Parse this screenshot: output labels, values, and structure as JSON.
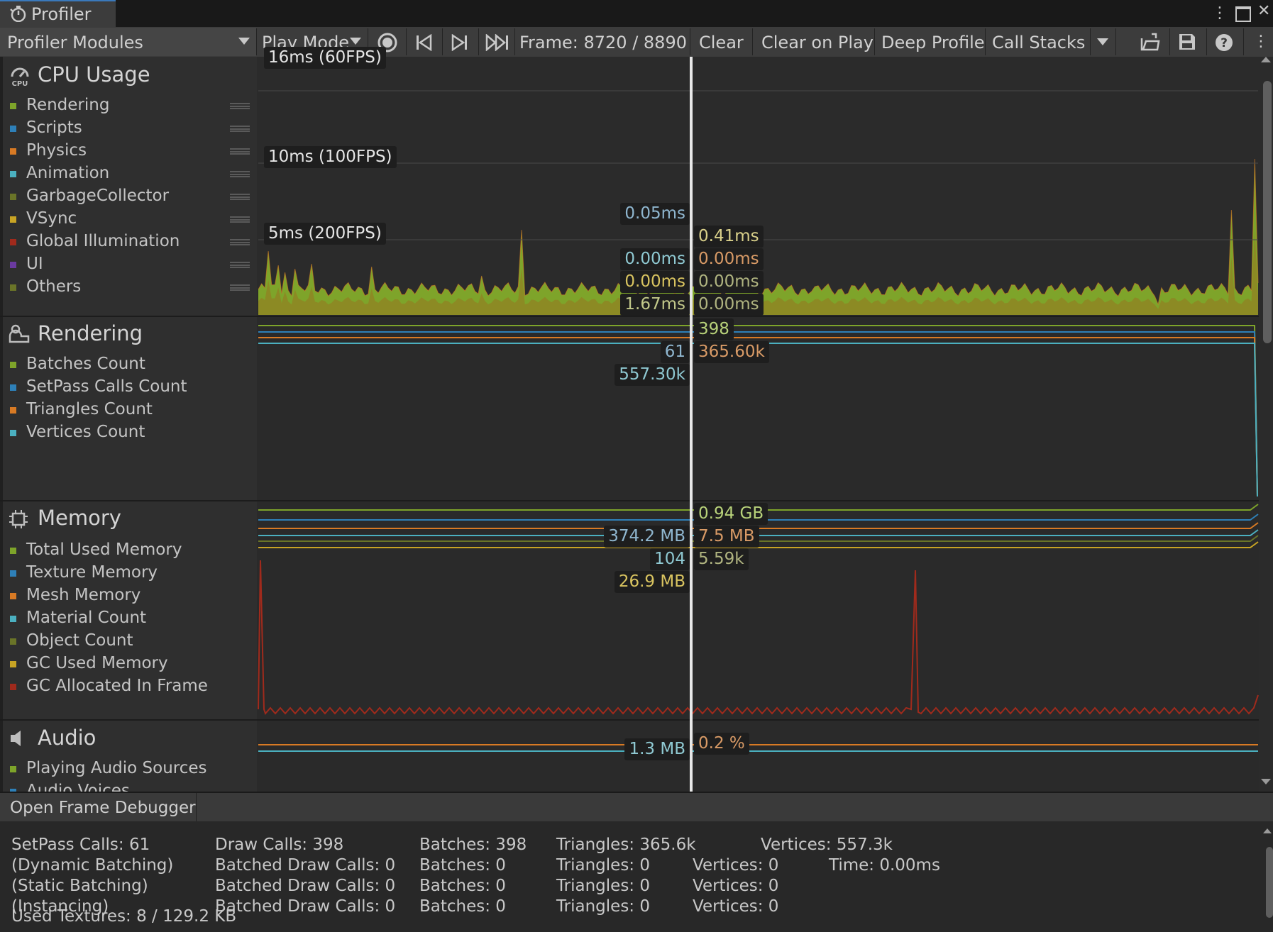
{
  "window": {
    "title": "Profiler"
  },
  "toolbar": {
    "modules_dropdown": "Profiler Modules",
    "play_mode": "Play Mode",
    "frame": "Frame: 8720 / 8890",
    "clear": "Clear",
    "clear_on_play": "Clear on Play",
    "deep_profile": "Deep Profile",
    "call_stacks": "Call Stacks"
  },
  "colors": {
    "green": "#7ea42a",
    "blue": "#2e80b8",
    "orange": "#d87a24",
    "teal": "#4bb0c0",
    "olive": "#6a7428",
    "yellow": "#c8a424",
    "red": "#a02a1c",
    "purple": "#6a3aa0",
    "cpu_fill": "#8c8a24"
  },
  "modules": {
    "cpu": {
      "title": "CPU Usage",
      "items": [
        "Rendering",
        "Scripts",
        "Physics",
        "Animation",
        "GarbageCollector",
        "VSync",
        "Global Illumination",
        "UI",
        "Others"
      ],
      "gridlines": [
        "16ms (60FPS)",
        "10ms (100FPS)",
        "5ms (200FPS)"
      ],
      "labels": [
        "0.05ms",
        "0.41ms",
        "0.00ms",
        "0.00ms",
        "0.00ms",
        "0.00ms",
        "1.67ms",
        "0.00ms"
      ]
    },
    "rendering": {
      "title": "Rendering",
      "items": [
        "Batches Count",
        "SetPass Calls Count",
        "Triangles Count",
        "Vertices Count"
      ],
      "labels": [
        "398",
        "61",
        "365.60k",
        "557.30k"
      ]
    },
    "memory": {
      "title": "Memory",
      "items": [
        "Total Used Memory",
        "Texture Memory",
        "Mesh Memory",
        "Material Count",
        "Object Count",
        "GC Used Memory",
        "GC Allocated In Frame"
      ],
      "labels": [
        "0.94 GB",
        "374.2 MB",
        "7.5 MB",
        "104",
        "5.59k",
        "26.9 MB"
      ]
    },
    "audio": {
      "title": "Audio",
      "items": [
        "Playing Audio Sources",
        "Audio Voices"
      ],
      "labels": [
        "1.3 MB",
        "0.2 %"
      ]
    }
  },
  "bottom": {
    "frame_debugger": "Open Frame Debugger",
    "rows": [
      [
        "SetPass Calls: 61",
        "Draw Calls: 398",
        "Batches: 398",
        "Triangles: 365.6k",
        "Vertices: 557.3k"
      ],
      [
        "(Dynamic Batching)",
        "Batched Draw Calls: 0",
        "Batches: 0",
        "Triangles: 0",
        "Vertices: 0",
        "Time: 0.00ms"
      ],
      [
        "(Static Batching)",
        "Batched Draw Calls: 0",
        "Batches: 0",
        "Triangles: 0",
        "Vertices: 0"
      ],
      [
        "(Instancing)",
        "Batched Draw Calls: 0",
        "Batches: 0",
        "Triangles: 0",
        "Vertices: 0"
      ]
    ],
    "used_textures": "Used Textures: 8 / 129.2 KB"
  }
}
